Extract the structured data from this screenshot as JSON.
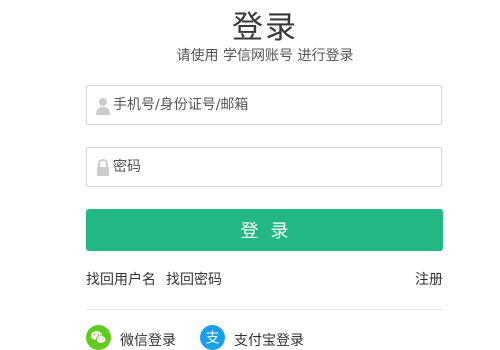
{
  "header": {
    "title": "登录",
    "subtitle": "请使用 学信网账号 进行登录"
  },
  "form": {
    "username_placeholder": "手机号/身份证号/邮箱",
    "username_value": "",
    "password_placeholder": "密码",
    "password_value": "",
    "username_icon": "user-icon",
    "password_icon": "lock-icon",
    "login_label": "登录"
  },
  "links": {
    "find_username": "找回用户名",
    "find_password": "找回密码",
    "register": "注册"
  },
  "social": [
    {
      "label": "微信登录",
      "icon": "wechat-icon",
      "color": "#5fcc1e"
    },
    {
      "label": "支付宝登录",
      "icon": "alipay-icon",
      "color": "#1a9fe8"
    }
  ],
  "colors": {
    "accent": "#22b784",
    "border": "#d8d8d8",
    "icon_gray": "#cccccc"
  }
}
